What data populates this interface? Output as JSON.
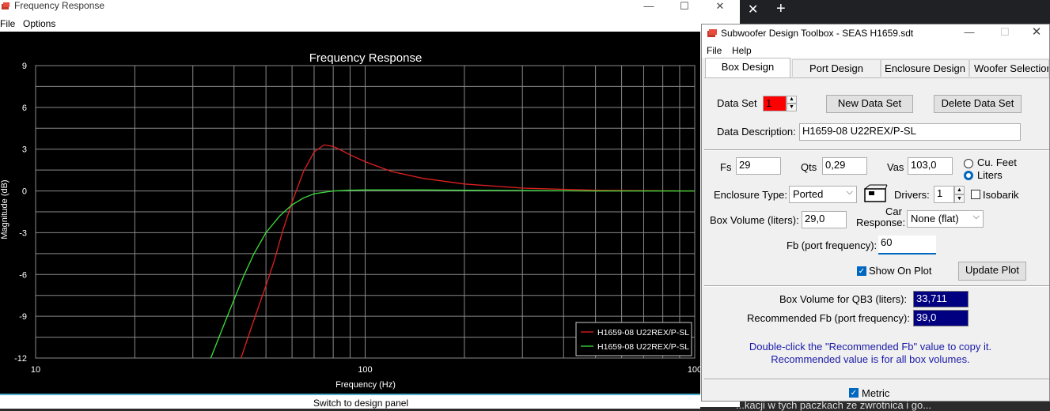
{
  "fr_window": {
    "title": "Frequency Response",
    "menu": [
      "File",
      "Options"
    ],
    "status": "Switch to design panel"
  },
  "toolbox": {
    "title": "Subwoofer Design Toolbox - SEAS H1659.sdt",
    "menu": [
      "File",
      "Help"
    ],
    "tabs": [
      "Box Design",
      "Port Design",
      "Enclosure Design",
      "Woofer Selection"
    ],
    "active_tab": "Box Design",
    "data_set_label": "Data Set",
    "data_set_value": "1",
    "new_data_set": "New Data Set",
    "delete_data_set": "Delete Data Set",
    "data_desc_label": "Data Description:",
    "data_desc_value": "H1659-08 U22REX/P-SL",
    "fs_label": "Fs",
    "fs_value": "29",
    "qts_label": "Qts",
    "qts_value": "0,29",
    "vas_label": "Vas",
    "vas_value": "103,0",
    "cu_feet": "Cu. Feet",
    "liters": "Liters",
    "enclosure_label": "Enclosure Type:",
    "enclosure_value": "Ported",
    "drivers_label": "Drivers:",
    "drivers_value": "1",
    "isobarik": "Isobarik",
    "box_volume_label": "Box Volume (liters):",
    "box_volume_value": "29,0",
    "car_label_1": "Car",
    "car_label_2": "Response:",
    "car_value": "None (flat)",
    "fb_label": "Fb (port frequency):",
    "fb_value": "60",
    "show_on_plot": "Show On Plot",
    "update_plot": "Update Plot",
    "qb3_label": "Box Volume for QB3 (liters):",
    "qb3_value": "33,711",
    "rec_fb_label": "Recommended Fb (port frequency):",
    "rec_fb_value": "39,0",
    "note_1": "Double-click the \"Recommended Fb\" value to copy it.",
    "note_2": "Recommended value is for all box volumes.",
    "metric": "Metric"
  },
  "background_text": "...kacji w tych paczkach ze zwrotnica i go...",
  "colors": {
    "plot_bg": "#000000",
    "grid": "#8a8a8a",
    "series_red": "#e02020",
    "series_green": "#3ce03c",
    "data_set_highlight": "#ff0000",
    "result_bg": "#000080"
  },
  "chart_data": {
    "type": "line",
    "title": "Frequency Response",
    "xlabel": "Frequency (Hz)",
    "ylabel": "Magnitude (dB)",
    "xscale": "log",
    "xlim": [
      10,
      1000
    ],
    "ylim": [
      -12,
      9
    ],
    "xticks": [
      "10",
      "100",
      "100"
    ],
    "yticks": [
      "9",
      "6",
      "3",
      "0",
      "-3",
      "-6",
      "-9",
      "-12"
    ],
    "grid": true,
    "legend_position": "bottom-right",
    "series": [
      {
        "name": "H1659-08 U22REX/P-SL",
        "color": "#e02020",
        "x": [
          42,
          45,
          48,
          50,
          53,
          56,
          60,
          65,
          70,
          75,
          80,
          85,
          90,
          100,
          120,
          150,
          200,
          300,
          500,
          1000
        ],
        "y": [
          -12,
          -9.9,
          -8.0,
          -6.8,
          -5.0,
          -3.0,
          -0.8,
          1.4,
          2.8,
          3.3,
          3.2,
          2.9,
          2.6,
          2.1,
          1.4,
          0.9,
          0.5,
          0.2,
          0.05,
          0.0
        ]
      },
      {
        "name": "H1659-08 U22REX/P-SL",
        "color": "#3ce03c",
        "x": [
          34,
          37,
          40,
          43,
          46,
          50,
          55,
          60,
          65,
          70,
          80,
          90,
          100,
          150,
          200,
          300,
          500,
          1000
        ],
        "y": [
          -12,
          -9.8,
          -7.8,
          -6.0,
          -4.5,
          -3.0,
          -1.8,
          -1.0,
          -0.5,
          -0.2,
          0.0,
          0.05,
          0.07,
          0.07,
          0.05,
          0.03,
          0.0,
          0.0
        ]
      }
    ]
  }
}
